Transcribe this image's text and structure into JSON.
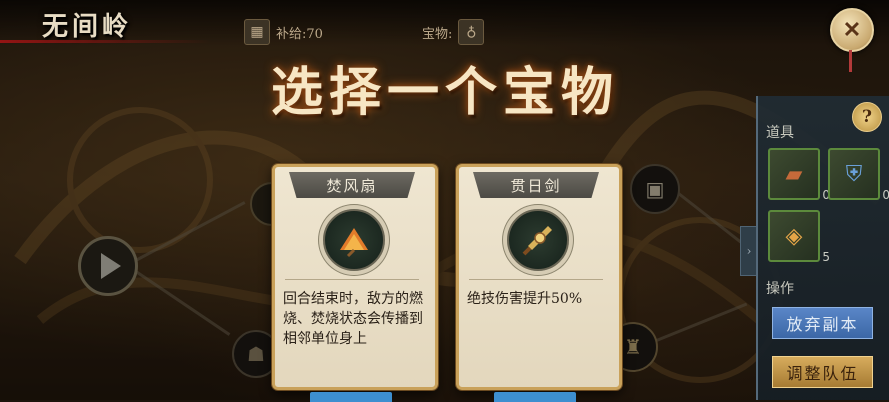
{
  "stage": {
    "name": "无间岭"
  },
  "resources": {
    "supply": {
      "icon": "supply-box-icon",
      "label": "补给:70"
    },
    "treasure": {
      "icon": "treasure-gourd-icon",
      "label": "宝物:"
    }
  },
  "dialog": {
    "title": "选择一个宝物",
    "cards": [
      {
        "name": "焚风扇",
        "icon": "fire-fan-icon",
        "description": "回合结束时，敌方的燃烧、焚烧状态会传播到相邻单位身上"
      },
      {
        "name": "贯日剑",
        "icon": "sun-sword-icon",
        "description": "绝技伤害提升50%"
      }
    ]
  },
  "side_panel": {
    "items_label": "道具",
    "items": [
      {
        "icon": "scroll-item-icon",
        "count": "0"
      },
      {
        "icon": "armor-item-icon",
        "count": "0"
      },
      {
        "icon": "token-item-icon",
        "count": "5"
      }
    ],
    "actions_label": "操作",
    "abandon_label": "放弃副本",
    "adjust_team_label": "调整队伍"
  },
  "colors": {
    "accent_blue": "#3d8fd0",
    "accent_gold": "#c9a15a",
    "close_red": "#b23a3a"
  }
}
